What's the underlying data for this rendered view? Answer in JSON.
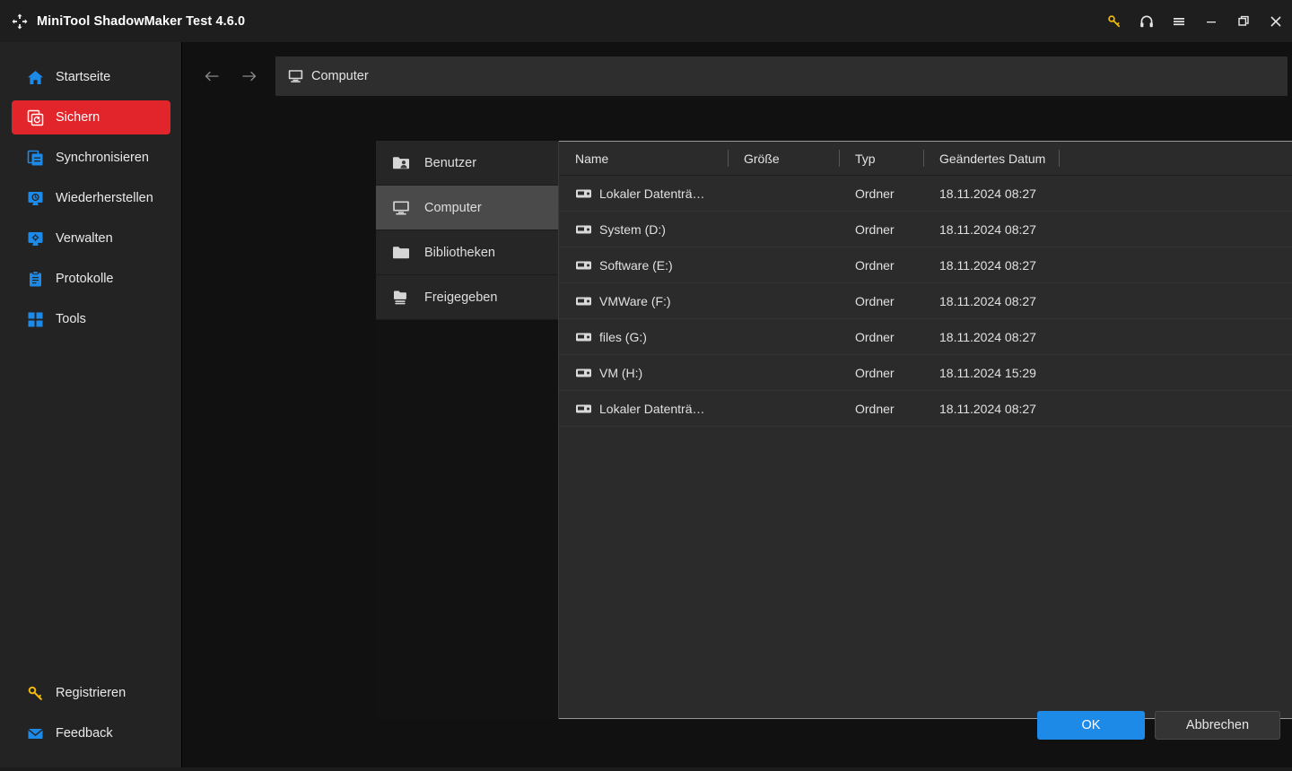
{
  "window": {
    "title": "MiniTool ShadowMaker Test 4.6.0",
    "logo_icon": "shadowmaker-logo-icon",
    "controls": [
      {
        "name": "key-icon",
        "glyph": "key",
        "color": "#f0b90b"
      },
      {
        "name": "headset-icon",
        "glyph": "headset",
        "color": "#e8e8e8"
      },
      {
        "name": "menu-icon",
        "glyph": "hamburger",
        "color": "#e8e8e8"
      },
      {
        "name": "minimize-icon",
        "glyph": "minimize",
        "color": "#e8e8e8"
      },
      {
        "name": "maximize-icon",
        "glyph": "restore",
        "color": "#e8e8e8"
      },
      {
        "name": "close-icon",
        "glyph": "close",
        "color": "#e8e8e8"
      }
    ]
  },
  "sidebar": {
    "items": [
      {
        "label": "Startseite",
        "icon": "home-icon",
        "active": false
      },
      {
        "label": "Sichern",
        "icon": "backup-icon",
        "active": true
      },
      {
        "label": "Synchronisieren",
        "icon": "sync-icon",
        "active": false
      },
      {
        "label": "Wiederherstellen",
        "icon": "restore-icon",
        "active": false
      },
      {
        "label": "Verwalten",
        "icon": "manage-icon",
        "active": false
      },
      {
        "label": "Protokolle",
        "icon": "logs-icon",
        "active": false
      },
      {
        "label": "Tools",
        "icon": "tools-icon",
        "active": false
      }
    ],
    "bottom_items": [
      {
        "label": "Registrieren",
        "icon": "key-icon"
      },
      {
        "label": "Feedback",
        "icon": "mail-icon"
      }
    ],
    "accent_color": "#e2252b",
    "icon_color": "#1e8ae8"
  },
  "navbar": {
    "back_icon": "arrow-left-icon",
    "forward_icon": "arrow-right-icon",
    "path_icon": "computer-icon",
    "path": "Computer"
  },
  "tree": {
    "items": [
      {
        "label": "Benutzer",
        "icon": "users-folder-icon",
        "selected": false
      },
      {
        "label": "Computer",
        "icon": "computer-icon",
        "selected": true
      },
      {
        "label": "Bibliotheken",
        "icon": "folder-icon",
        "selected": false
      },
      {
        "label": "Freigegeben",
        "icon": "shared-folder-icon",
        "selected": false
      }
    ]
  },
  "filetable": {
    "columns": [
      "Name",
      "Größe",
      "Typ",
      "Geändertes Datum"
    ],
    "rows": [
      {
        "name": "Lokaler Datenträ…",
        "size": "",
        "type": "Ordner",
        "date": "18.11.2024 08:27",
        "icon": "drive-icon"
      },
      {
        "name": "System (D:)",
        "size": "",
        "type": "Ordner",
        "date": "18.11.2024 08:27",
        "icon": "drive-icon"
      },
      {
        "name": "Software (E:)",
        "size": "",
        "type": "Ordner",
        "date": "18.11.2024 08:27",
        "icon": "drive-icon"
      },
      {
        "name": "VMWare (F:)",
        "size": "",
        "type": "Ordner",
        "date": "18.11.2024 08:27",
        "icon": "drive-icon"
      },
      {
        "name": "files (G:)",
        "size": "",
        "type": "Ordner",
        "date": "18.11.2024 08:27",
        "icon": "drive-icon"
      },
      {
        "name": "VM (H:)",
        "size": "",
        "type": "Ordner",
        "date": "18.11.2024 15:29",
        "icon": "drive-icon"
      },
      {
        "name": "Lokaler Datenträ…",
        "size": "",
        "type": "Ordner",
        "date": "18.11.2024 08:27",
        "icon": "drive-icon"
      }
    ]
  },
  "footer": {
    "ok_label": "OK",
    "cancel_label": "Abbrechen",
    "ok_color": "#1e8ae8"
  }
}
